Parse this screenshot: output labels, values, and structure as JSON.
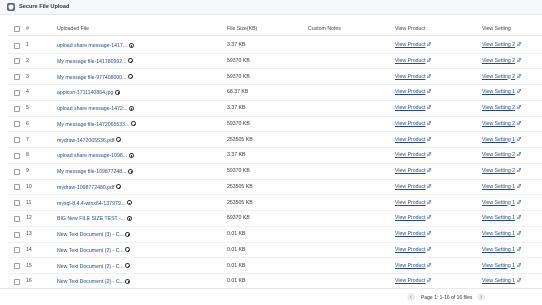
{
  "header": {
    "title": "Secure File Upload",
    "icon": "shield-icon"
  },
  "table": {
    "columns": {
      "num": "#",
      "file": "Uploaded File",
      "size": "File Size(KB)",
      "notes": "Custom Notes",
      "product": "View Product",
      "setting": "View Setting"
    },
    "rows": [
      {
        "num": "1",
        "file": "upload share message-1417...",
        "size": "3.37 KB",
        "product": "View Product",
        "setting": "View Setting 2"
      },
      {
        "num": "2",
        "file": "My message file-141780992...",
        "size": "59370 KB",
        "product": "View Product",
        "setting": "View Setting 2"
      },
      {
        "num": "3",
        "file": "My message file-977408000...",
        "size": "59370 KB",
        "product": "View Product",
        "setting": "View Setting 2"
      },
      {
        "num": "4",
        "file": "appicon-1711140864.jpg",
        "size": "68.37 KB",
        "product": "View Product",
        "setting": "View Setting 1"
      },
      {
        "num": "5",
        "file": "upload share message-1472...",
        "size": "3.37 KB",
        "product": "View Product",
        "setting": "View Setting 2"
      },
      {
        "num": "6",
        "file": "My message file-1472065533...",
        "size": "59370 KB",
        "product": "View Product",
        "setting": "View Setting 2"
      },
      {
        "num": "7",
        "file": "mydraw-1472065536.pdf",
        "size": "253505 KB",
        "product": "View Product",
        "setting": "View Setting 1"
      },
      {
        "num": "8",
        "file": "upload share message-1098...",
        "size": "3.37 KB",
        "product": "View Product",
        "setting": "View Setting 2"
      },
      {
        "num": "9",
        "file": "My message file-109877248...",
        "size": "59370 KB",
        "product": "View Product",
        "setting": "View Setting 2"
      },
      {
        "num": "10",
        "file": "mydraw-1098772480.pdf",
        "size": "253505 KB",
        "product": "View Product",
        "setting": "View Setting 1"
      },
      {
        "num": "11",
        "file": "mysql-8.4.4-winx64-137979...",
        "size": "253505 KB",
        "product": "View Product",
        "setting": "View Setting 1"
      },
      {
        "num": "12",
        "file": "BIG New FILE SIZE TEST -...",
        "size": "59370 KB",
        "product": "View Product",
        "setting": "View Setting 1"
      },
      {
        "num": "13",
        "file": "New Text Document (3) - C...",
        "size": "0.01 KB",
        "product": "View Product",
        "setting": "View Setting 1"
      },
      {
        "num": "14",
        "file": "New Text Document (2) - C...",
        "size": "0.01 KB",
        "product": "View Product",
        "setting": "View Setting 1"
      },
      {
        "num": "15",
        "file": "New Text Document (2) - C...",
        "size": "0.01 KB",
        "product": "View Product",
        "setting": "View Setting 1"
      },
      {
        "num": "16",
        "file": "New Text Document (2) - C...",
        "size": "0.01 KB",
        "product": "View Product",
        "setting": "View Setting 1"
      }
    ]
  },
  "pagination": {
    "label": "Page 1: 1-16 of 16 files",
    "prev_icon": "chevron-left-icon",
    "next_icon": "chevron-right-icon"
  },
  "colors": {
    "link": "#2c4a8a",
    "header_bg": "#f7f8fa",
    "border": "#e6e8eb"
  }
}
